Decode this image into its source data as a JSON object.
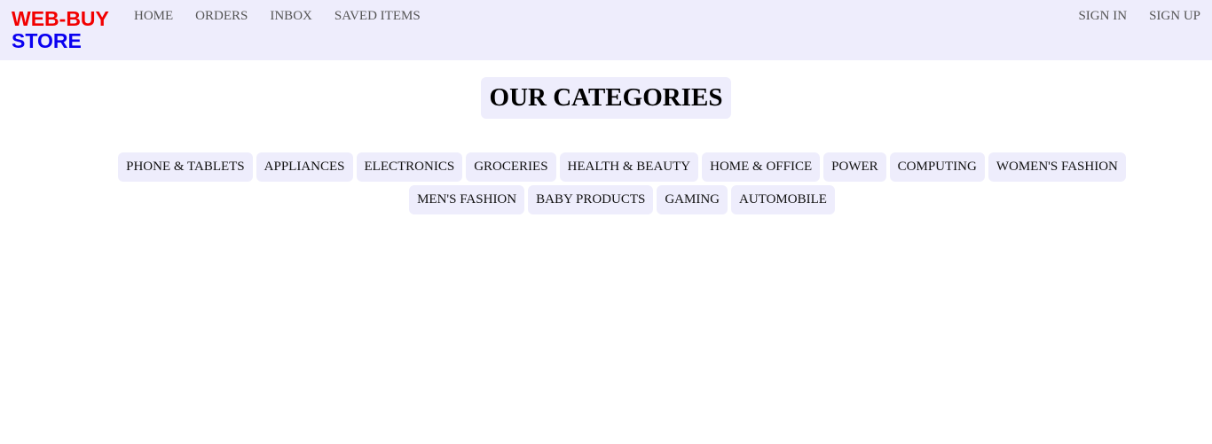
{
  "brand": {
    "line1": "WEB-BUY",
    "line2": "STORE",
    "line1_color": "#f20000",
    "line2_color": "#0a00f0"
  },
  "nav": {
    "left": [
      {
        "label": "HOME"
      },
      {
        "label": "ORDERS"
      },
      {
        "label": "INBOX"
      },
      {
        "label": "SAVED ITEMS"
      }
    ],
    "right": [
      {
        "label": "SIGN IN"
      },
      {
        "label": "SIGN UP"
      }
    ]
  },
  "main": {
    "title": "OUR CATEGORIES",
    "categories": [
      {
        "label": "PHONE & TABLETS"
      },
      {
        "label": "APPLIANCES"
      },
      {
        "label": "ELECTRONICS"
      },
      {
        "label": "GROCERIES"
      },
      {
        "label": "HEALTH & BEAUTY"
      },
      {
        "label": "HOME & OFFICE"
      },
      {
        "label": "POWER"
      },
      {
        "label": "COMPUTING"
      },
      {
        "label": "WOMEN'S FASHION"
      },
      {
        "label": "MEN'S FASHION"
      },
      {
        "label": "BABY PRODUCTS"
      },
      {
        "label": "GAMING"
      },
      {
        "label": "AUTOMOBILE"
      }
    ]
  },
  "colors": {
    "nav_background": "#eeedfc",
    "chip_background": "#eeedfc"
  }
}
